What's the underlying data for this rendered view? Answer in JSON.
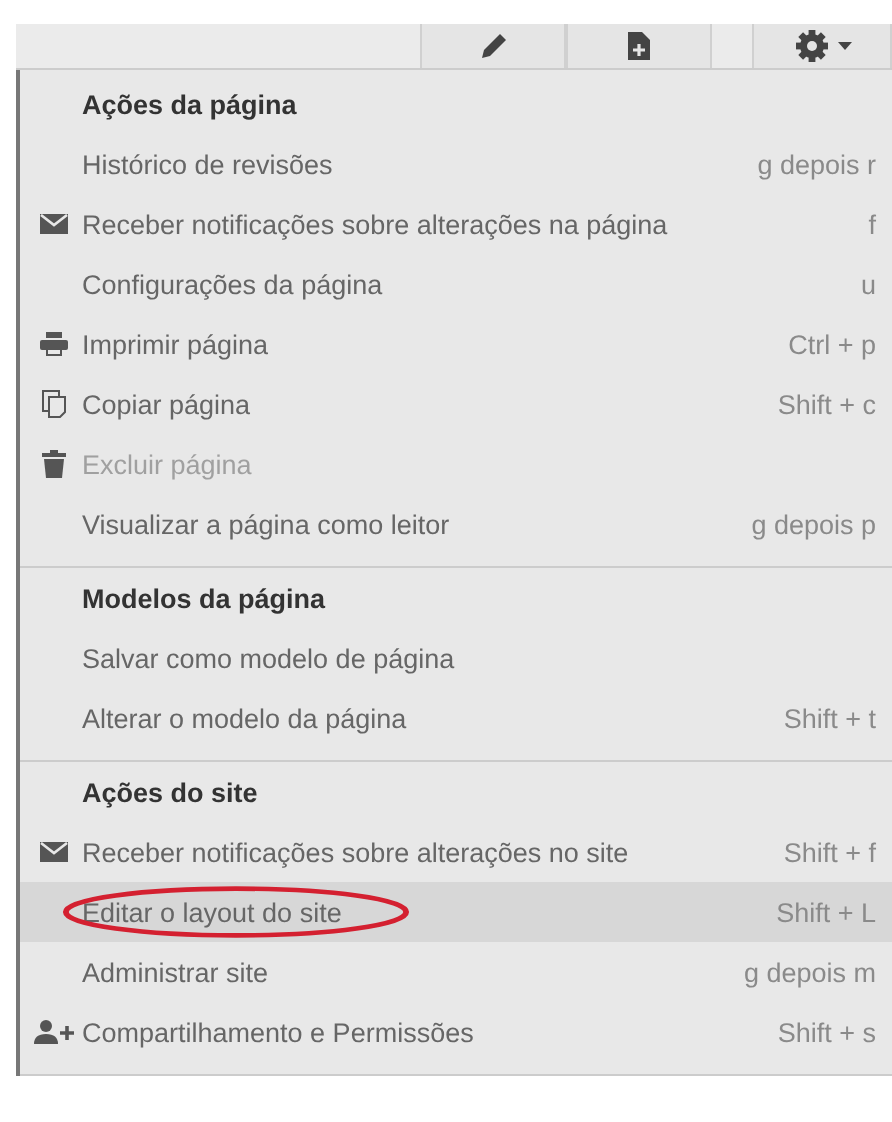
{
  "toolbar": {
    "buttons": [
      {
        "kind": "edit"
      },
      {
        "kind": "new-page"
      },
      {
        "kind": "settings"
      }
    ]
  },
  "menu": {
    "sections": [
      {
        "title": "Ações da página",
        "items": [
          {
            "label": "Histórico de revisões",
            "shortcut": "g depois r",
            "kind": "plain",
            "disabled": false,
            "selected": false,
            "circled": false
          },
          {
            "label": "Receber notificações sobre alterações na página",
            "shortcut": "f",
            "kind": "mail",
            "disabled": false,
            "selected": false,
            "circled": false
          },
          {
            "label": "Configurações da página",
            "shortcut": "u",
            "kind": "plain",
            "disabled": false,
            "selected": false,
            "circled": false
          },
          {
            "label": "Imprimir página",
            "shortcut": "Ctrl + p",
            "kind": "print",
            "disabled": false,
            "selected": false,
            "circled": false
          },
          {
            "label": "Copiar página",
            "shortcut": "Shift + c",
            "kind": "copy",
            "disabled": false,
            "selected": false,
            "circled": false
          },
          {
            "label": "Excluir página",
            "kind": "delete",
            "disabled": true,
            "selected": false,
            "circled": false
          },
          {
            "label": "Visualizar a página como leitor",
            "shortcut": "g depois p",
            "kind": "plain",
            "disabled": false,
            "selected": false,
            "circled": false
          }
        ]
      },
      {
        "title": "Modelos da página",
        "items": [
          {
            "label": "Salvar como modelo de página",
            "kind": "plain",
            "disabled": false,
            "selected": false,
            "circled": false
          },
          {
            "label": "Alterar o modelo da página",
            "shortcut": "Shift + t",
            "kind": "plain",
            "disabled": false,
            "selected": false,
            "circled": false
          }
        ]
      },
      {
        "title": "Ações do site",
        "items": [
          {
            "label": "Receber notificações sobre alterações no site",
            "shortcut": "Shift + f",
            "kind": "mail",
            "disabled": false,
            "selected": false,
            "circled": false
          },
          {
            "label": "Editar o layout do site",
            "shortcut": "Shift + L",
            "kind": "plain",
            "disabled": false,
            "selected": true,
            "circled": true
          },
          {
            "label": "Administrar site",
            "shortcut": "g depois m",
            "kind": "plain",
            "disabled": false,
            "selected": false,
            "circled": false
          },
          {
            "label": "Compartilhamento e Permissões",
            "shortcut": "Shift + s",
            "kind": "share",
            "disabled": false,
            "selected": false,
            "circled": false
          }
        ]
      }
    ]
  }
}
